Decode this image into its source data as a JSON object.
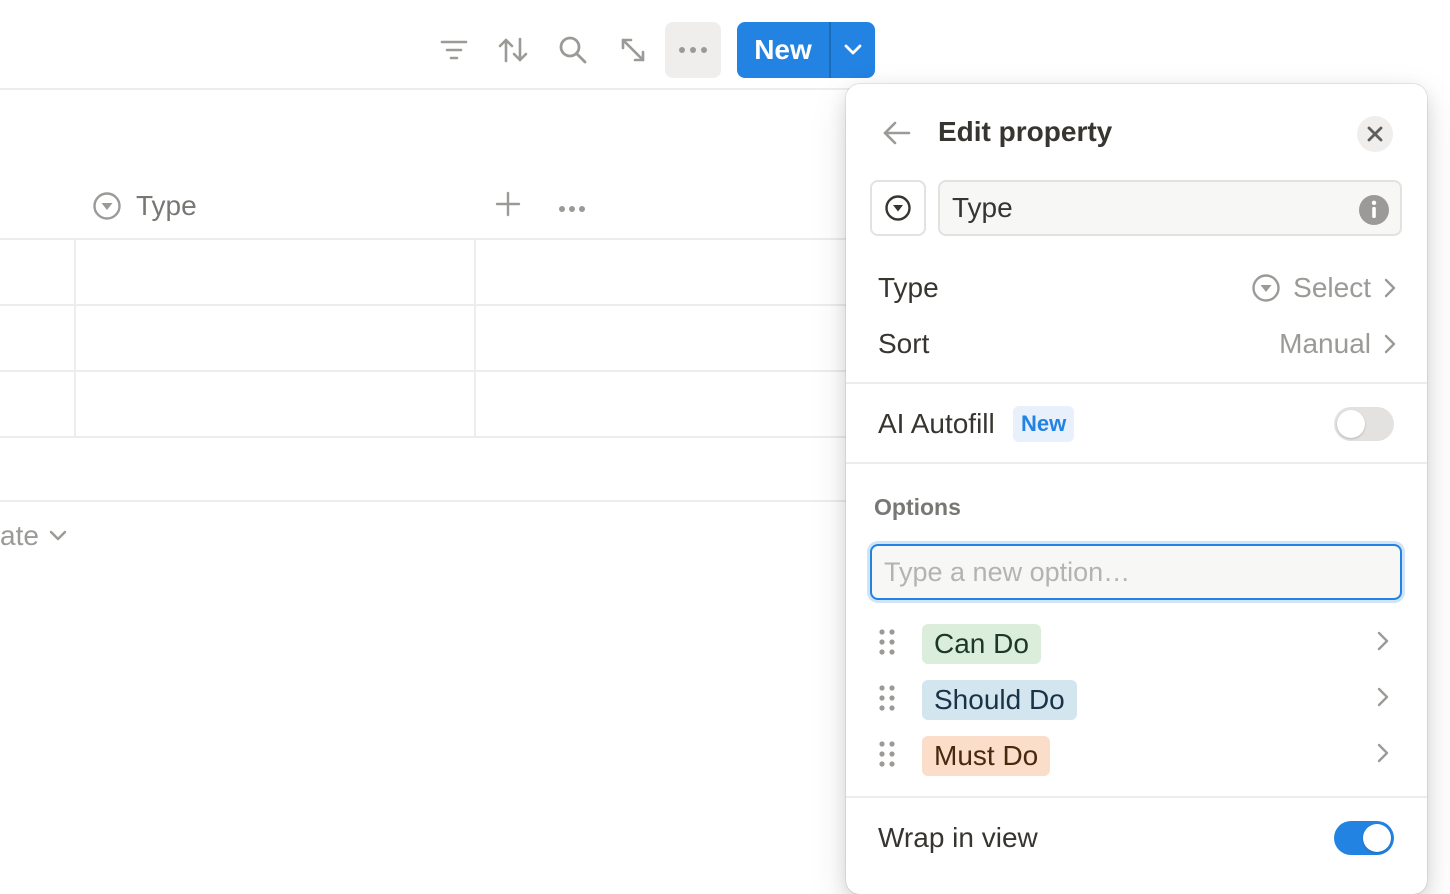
{
  "toolbar": {
    "icons": [
      "filter-icon",
      "sort-icon",
      "search-icon",
      "expand-icon",
      "more-icon"
    ],
    "new_label": "New"
  },
  "table": {
    "column_header": "Type",
    "group_label_partial": "ate"
  },
  "panel": {
    "title": "Edit property",
    "name_value": "Type",
    "type_label": "Type",
    "type_value": "Select",
    "sort_label": "Sort",
    "sort_value": "Manual",
    "ai_autofill_label": "AI Autofill",
    "ai_autofill_badge": "New",
    "ai_autofill_on": false,
    "options_heading": "Options",
    "option_placeholder": "Type a new option…",
    "options": [
      {
        "label": "Can Do",
        "bg": "#dbeddb",
        "fg": "#1c3829"
      },
      {
        "label": "Should Do",
        "bg": "#d3e5ef",
        "fg": "#183347"
      },
      {
        "label": "Must Do",
        "bg": "#fadec9",
        "fg": "#49290e"
      }
    ],
    "wrap_label": "Wrap in view",
    "wrap_on": true
  },
  "colors": {
    "accent": "#2383e2",
    "toggle_off": "#e3e2e0"
  }
}
